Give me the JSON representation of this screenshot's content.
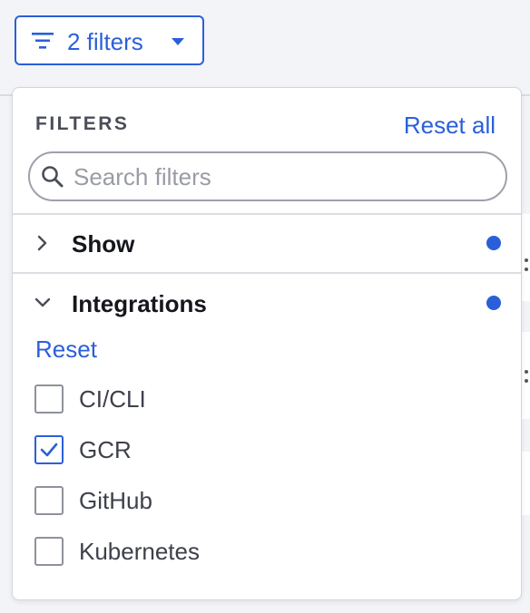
{
  "toolbar": {
    "filter_button_label": "2 filters",
    "filter_icon": "filter-lines-icon",
    "caret_icon": "caret-down-icon"
  },
  "panel": {
    "title": "FILTERS",
    "reset_all_label": "Reset all",
    "search_placeholder": "Search filters",
    "search_value": "",
    "sections": [
      {
        "label": "Show",
        "expanded": false,
        "active_indicator": true
      },
      {
        "label": "Integrations",
        "expanded": true,
        "active_indicator": true
      }
    ],
    "integrations": {
      "reset_label": "Reset",
      "options": [
        {
          "label": "CI/CLI",
          "checked": false
        },
        {
          "label": "GCR",
          "checked": true
        },
        {
          "label": "GitHub",
          "checked": false
        },
        {
          "label": "Kubernetes",
          "checked": false
        }
      ]
    }
  },
  "colors": {
    "accent": "#2b5fd9",
    "page_bg": "#f3f4f8",
    "panel_bg": "#ffffff",
    "text_dark": "#15171c",
    "text_muted": "#4b4e58"
  }
}
